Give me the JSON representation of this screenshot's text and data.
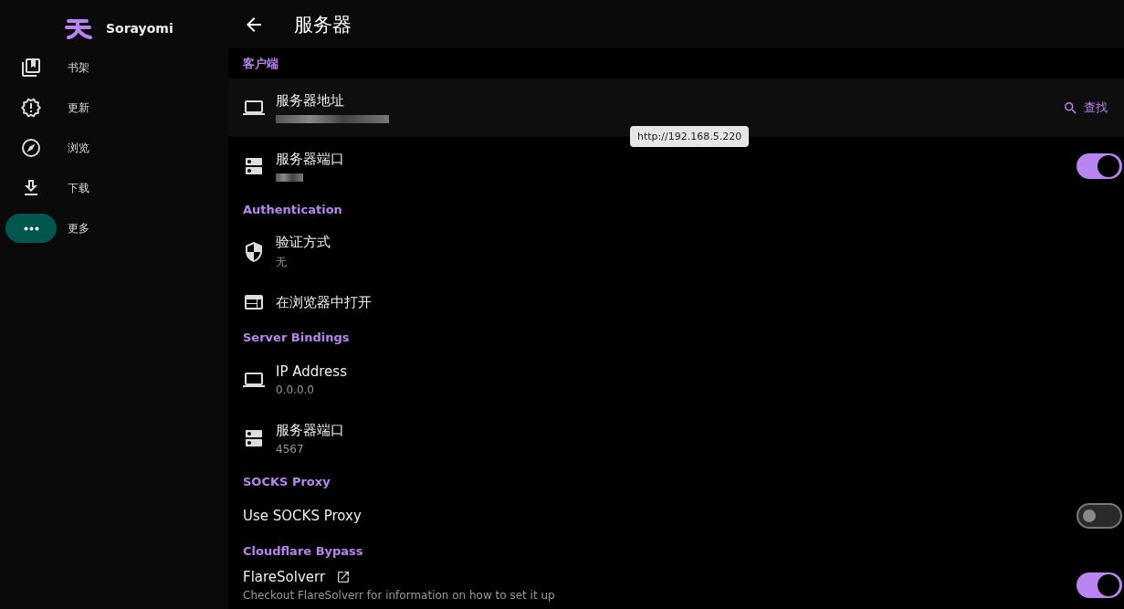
{
  "sidebar": {
    "app_name": "Sorayomi",
    "items": [
      {
        "label": "书架",
        "selected": false
      },
      {
        "label": "更新",
        "selected": false
      },
      {
        "label": "浏览",
        "selected": false
      },
      {
        "label": "下载",
        "selected": false
      },
      {
        "label": "更多",
        "selected": true
      }
    ]
  },
  "header": {
    "title": "服务器"
  },
  "sections": [
    {
      "title": "客户端",
      "rows": [
        {
          "title": "服务器地址",
          "value_redacted": true,
          "hovered": true,
          "action": {
            "label": "查找"
          }
        },
        {
          "title": "服务器端口",
          "value_redacted": true,
          "hovered": false,
          "toggle": {
            "on": true
          }
        }
      ]
    },
    {
      "title": "Authentication",
      "rows": [
        {
          "title": "验证方式",
          "value": "无",
          "hovered": false
        },
        {
          "title": "在浏览器中打开",
          "hovered": false
        }
      ]
    },
    {
      "title": "Server Bindings",
      "rows": [
        {
          "title": "IP Address",
          "value": "0.0.0.0",
          "hovered": false
        },
        {
          "title": "服务器端口",
          "value": "4567",
          "hovered": false
        }
      ]
    },
    {
      "title": "SOCKS Proxy",
      "rows": [
        {
          "title": "Use SOCKS Proxy",
          "hovered": false,
          "toggle": {
            "on": false
          }
        }
      ]
    },
    {
      "title": "Cloudflare Bypass",
      "rows": [
        {
          "title": "FlareSolverr",
          "external_link": true,
          "hovered": false,
          "toggle": {
            "on": true
          },
          "description": "Checkout FlareSolverr for information on how to set it up"
        }
      ]
    }
  ],
  "tooltip": {
    "text": "http://192.168.5.220"
  }
}
